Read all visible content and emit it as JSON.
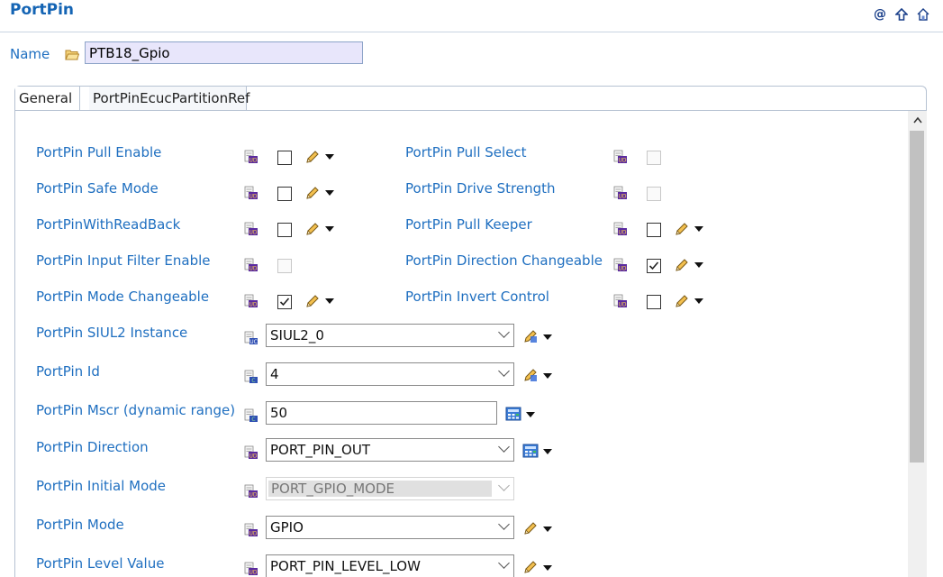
{
  "header": {
    "title": "PortPin",
    "icons": [
      "at-icon",
      "up-arrow-icon",
      "home-icon"
    ]
  },
  "name_field": {
    "label": "Name",
    "value": "PTB18_Gpio"
  },
  "tabs": [
    {
      "label": "General",
      "active": true
    },
    {
      "label": "PortPinEcucPartitionRef",
      "active": false
    }
  ],
  "left_checks": [
    {
      "label": "PortPin Pull Enable",
      "checked": false,
      "enabled": true
    },
    {
      "label": "PortPin Safe Mode",
      "checked": false,
      "enabled": true
    },
    {
      "label": "PortPinWithReadBack",
      "checked": false,
      "enabled": true
    },
    {
      "label": "PortPin Input Filter Enable",
      "checked": false,
      "enabled": false
    },
    {
      "label": "PortPin Mode Changeable",
      "checked": true,
      "enabled": true
    }
  ],
  "right_checks": [
    {
      "label": "PortPin Pull Select",
      "checked": false,
      "enabled": false
    },
    {
      "label": "PortPin Drive Strength",
      "checked": false,
      "enabled": false
    },
    {
      "label": "PortPin Pull Keeper",
      "checked": false,
      "enabled": true
    },
    {
      "label": "PortPin Direction Changeable",
      "checked": true,
      "enabled": true
    },
    {
      "label": "PortPin Invert Control",
      "checked": false,
      "enabled": true
    }
  ],
  "fields": [
    {
      "label": "PortPin SIUL2 Instance",
      "value": "SIUL2_0",
      "type": "combo"
    },
    {
      "label": "PortPin Id",
      "value": "4",
      "type": "combo"
    },
    {
      "label": "PortPin Mscr (dynamic range)",
      "value": "50",
      "type": "text"
    },
    {
      "label": "PortPin Direction",
      "value": "PORT_PIN_OUT",
      "type": "combo"
    },
    {
      "label": "PortPin Initial Mode",
      "value": "PORT_GPIO_MODE",
      "type": "combo-disabled"
    },
    {
      "label": "PortPin Mode",
      "value": "GPIO",
      "type": "combo"
    },
    {
      "label": "PortPin Level Value",
      "value": "PORT_PIN_LEVEL_LOW",
      "type": "combo"
    }
  ],
  "colors": {
    "label_blue": "#1f6fc0",
    "title_blue": "#1464b4",
    "name_bg": "#e8e6fb"
  }
}
